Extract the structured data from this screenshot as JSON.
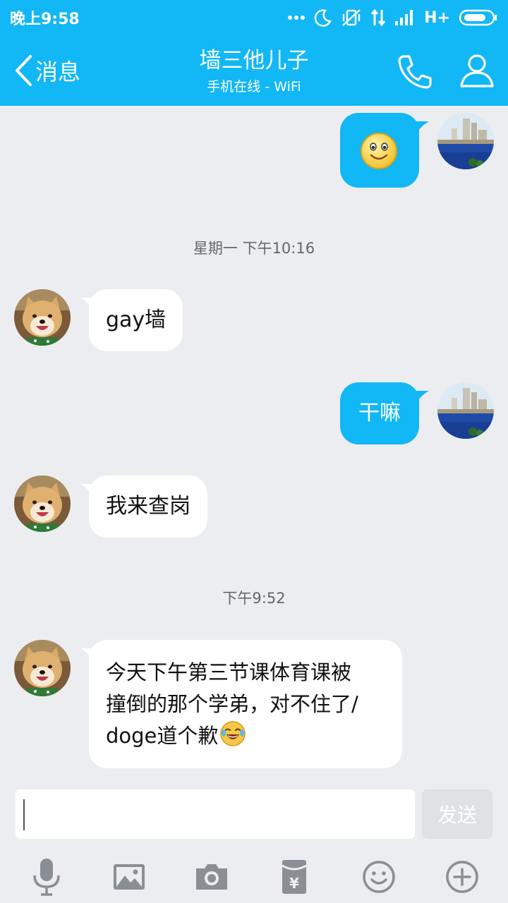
{
  "status_bar": {
    "time": "晚上9:58",
    "network": "H+"
  },
  "header": {
    "back_label": "消息",
    "title": "墙三他儿子",
    "subtitle": "手机在线 - WiFi"
  },
  "messages": [
    {
      "side": "out",
      "type": "emoji",
      "emoji": "smiley-emoji"
    },
    {
      "type": "timestamp",
      "text": "星期一 下午10:16"
    },
    {
      "side": "in",
      "text": "gay墙"
    },
    {
      "side": "out",
      "text": "干嘛"
    },
    {
      "side": "in",
      "text": "我来查岗"
    },
    {
      "type": "timestamp",
      "text": "下午9:52"
    },
    {
      "side": "in",
      "lines": [
        "今天下午第三节课体育课被",
        "撞倒的那个学弟，对不住了/",
        "doge道个歉"
      ],
      "trailing_emoji": "laughing-tears-emoji"
    }
  ],
  "input": {
    "value": "",
    "send_label": "发送"
  },
  "toolbar": [
    "microphone-icon",
    "image-icon",
    "camera-icon",
    "red-packet-icon",
    "emoji-icon",
    "plus-icon"
  ],
  "colors": {
    "accent": "#12b7f5",
    "background": "#ebedf0",
    "bubble_in": "#ffffff"
  }
}
